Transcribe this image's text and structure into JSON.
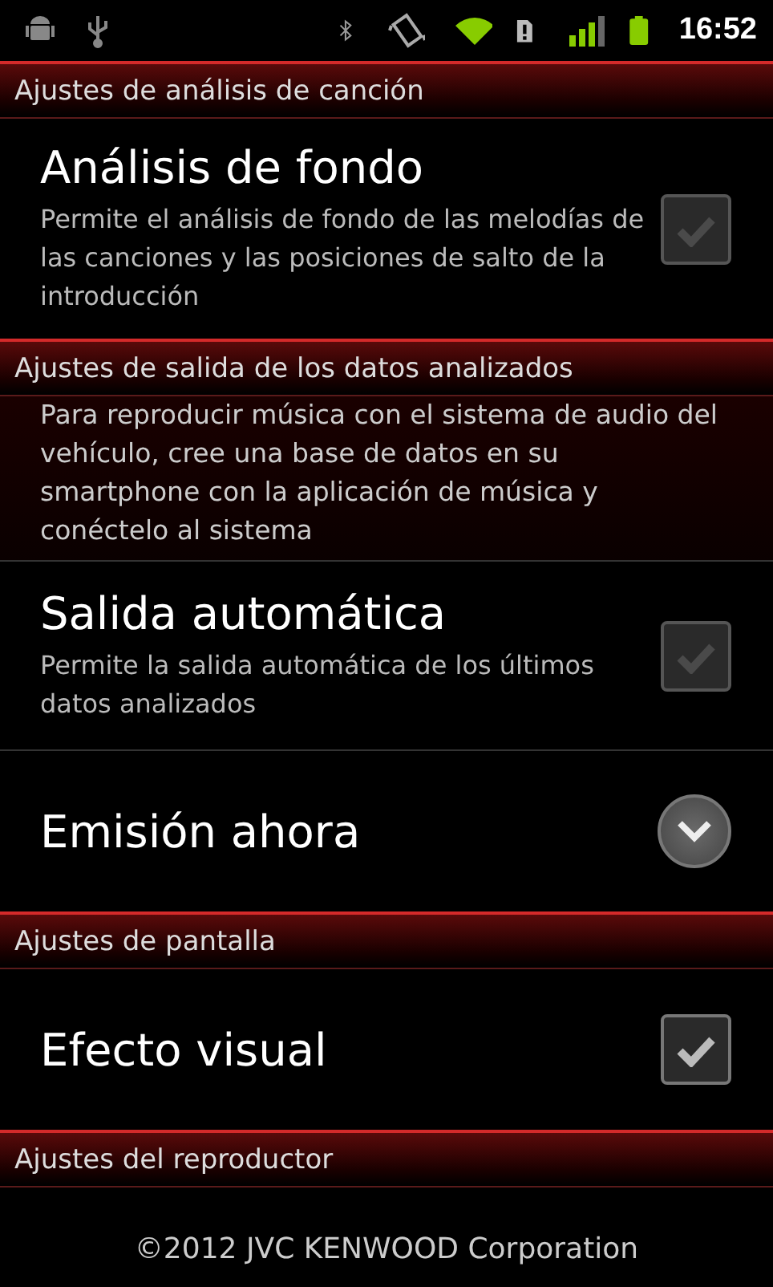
{
  "status_bar": {
    "time": "16:52"
  },
  "sections": [
    {
      "title": "Ajustes de análisis de canción",
      "items": [
        {
          "kind": "checkbox",
          "title": "Análisis de fondo",
          "summary": "Permite el análisis de fondo de las melodías de las canciones y las posiciones de salto de la introducción",
          "checked": true,
          "disabled": true
        }
      ]
    },
    {
      "title": "Ajustes de salida de los datos analizados",
      "description": "Para reproducir música con el sistema de audio del vehículo, cree una base de datos en su smartphone con la aplicación de música y conéctelo al sistema",
      "items": [
        {
          "kind": "checkbox",
          "title": "Salida automática",
          "summary": "Permite la salida automática de los últimos datos analizados",
          "checked": true,
          "disabled": true
        },
        {
          "kind": "expander",
          "title": "Emisión ahora"
        }
      ]
    },
    {
      "title": "Ajustes de pantalla",
      "items": [
        {
          "kind": "checkbox",
          "title": "Efecto visual",
          "checked": true,
          "disabled": false
        }
      ]
    },
    {
      "title": "Ajustes del reproductor"
    }
  ],
  "footer": "©2012 JVC KENWOOD Corporation"
}
